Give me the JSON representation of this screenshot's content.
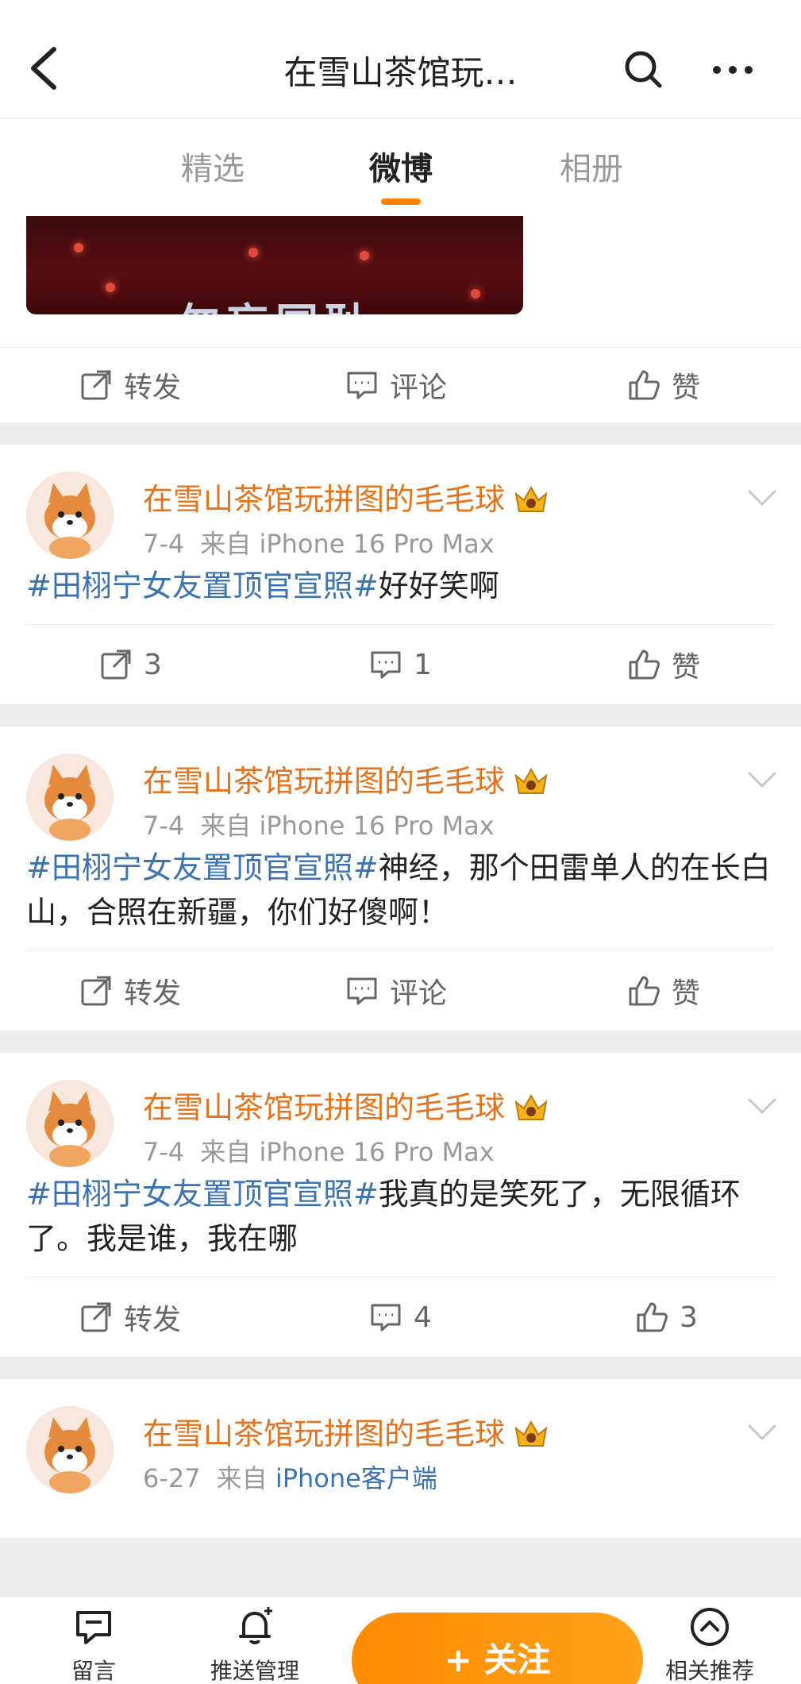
{
  "header": {
    "title": "在雪山茶馆玩…",
    "icons": [
      "back-arrow-icon",
      "search-icon",
      "more-icon"
    ]
  },
  "tabs": [
    {
      "label": "精选",
      "active": false
    },
    {
      "label": "微博",
      "active": true
    },
    {
      "label": "相册",
      "active": false
    }
  ],
  "accent_color": "#ff8200",
  "first_card": {
    "image_text": "勿忘国耻",
    "actions": {
      "repost": "转发",
      "comment": "评论",
      "like": "赞"
    }
  },
  "posts": [
    {
      "author": "在雪山茶馆玩拼图的毛毛球",
      "date": "7-4",
      "source_prefix": "来自",
      "source": "iPhone 16 Pro Max",
      "hashtag": "#田栩宁女友置顶官宣照#",
      "text": "好好笑啊",
      "actions": {
        "repost": "3",
        "comment": "1",
        "like": "赞"
      }
    },
    {
      "author": "在雪山茶馆玩拼图的毛毛球",
      "date": "7-4",
      "source_prefix": "来自",
      "source": "iPhone 16 Pro Max",
      "hashtag": "#田栩宁女友置顶官宣照#",
      "text": "神经，那个田雷单人的在长白山，合照在新疆，你们好傻啊！",
      "actions": {
        "repost": "转发",
        "comment": "评论",
        "like": "赞"
      }
    },
    {
      "author": "在雪山茶馆玩拼图的毛毛球",
      "date": "7-4",
      "source_prefix": "来自",
      "source": "iPhone 16 Pro Max",
      "hashtag": "#田栩宁女友置顶官宣照#",
      "text": "我真的是笑死了，无限循环了。我是谁，我在哪",
      "actions": {
        "repost": "转发",
        "comment": "4",
        "like": "3"
      }
    },
    {
      "author": "在雪山茶馆玩拼图的毛毛球",
      "date": "6-27",
      "source_prefix": "来自",
      "source": "iPhone客户端"
    }
  ],
  "bottom_bar": {
    "message": "留言",
    "push": "推送管理",
    "follow": "+ 关注",
    "related": "相关推荐"
  }
}
